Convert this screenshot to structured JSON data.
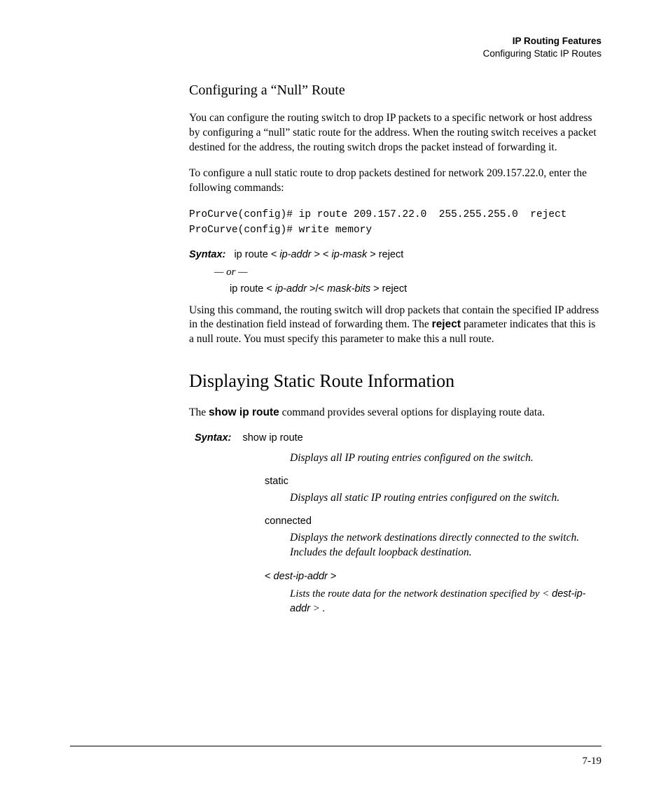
{
  "header": {
    "chapter": "IP Routing Features",
    "section": "Configuring Static IP Routes"
  },
  "sec1": {
    "title": "Configuring a “Null” Route",
    "p1": "You can configure the routing switch to drop IP packets to a specific network or host address by configuring a “null” static route for the address. When the routing switch receives a packet destined for the address, the routing switch drops the packet instead of forwarding it.",
    "p2": "To configure a null static route to drop packets destined for network 209.157.22.0, enter the following commands:",
    "code": "ProCurve(config)# ip route 209.157.22.0  255.255.255.0  reject\nProCurve(config)# write memory",
    "syntax_label": "Syntax:",
    "syntax1_pre": "ip route < ",
    "syntax1_arg1": "ip-addr",
    "syntax1_mid": " > < ",
    "syntax1_arg2": "ip-mask",
    "syntax1_post": " > reject",
    "or": "— or —",
    "syntax2_pre": "ip route < ",
    "syntax2_arg1": "ip-addr",
    "syntax2_mid": " >/< ",
    "syntax2_arg2": "mask-bits",
    "syntax2_post": " > reject",
    "p3a": "Using this command, the routing switch will drop packets that contain the specified IP address in the destination field instead of forwarding them. The ",
    "p3b": "reject",
    "p3c": " parameter indicates that this is a null route. You must specify this parameter to make this a null route."
  },
  "sec2": {
    "title": "Displaying Static Route Information",
    "p1a": "The ",
    "p1b": "show ip route",
    "p1c": " command provides several options for displaying route data.",
    "syntax_label": "Syntax:",
    "syntax_cmd": "show ip route",
    "desc_all": "Displays all IP routing entries configured on the switch.",
    "opt1": "static",
    "opt1_desc": "Displays all static IP routing entries configured on the switch.",
    "opt2": "connected",
    "opt2_desc": "Displays the network destinations directly connected to the switch. Includes the default loopback destination.",
    "opt3_pre": "< ",
    "opt3_arg": "dest-ip-addr",
    "opt3_post": " >",
    "opt3_desc_a": "Lists the route data for the network destination specified by < ",
    "opt3_desc_arg": "dest-ip-addr",
    "opt3_desc_b": " > ."
  },
  "page_number": "7-19"
}
